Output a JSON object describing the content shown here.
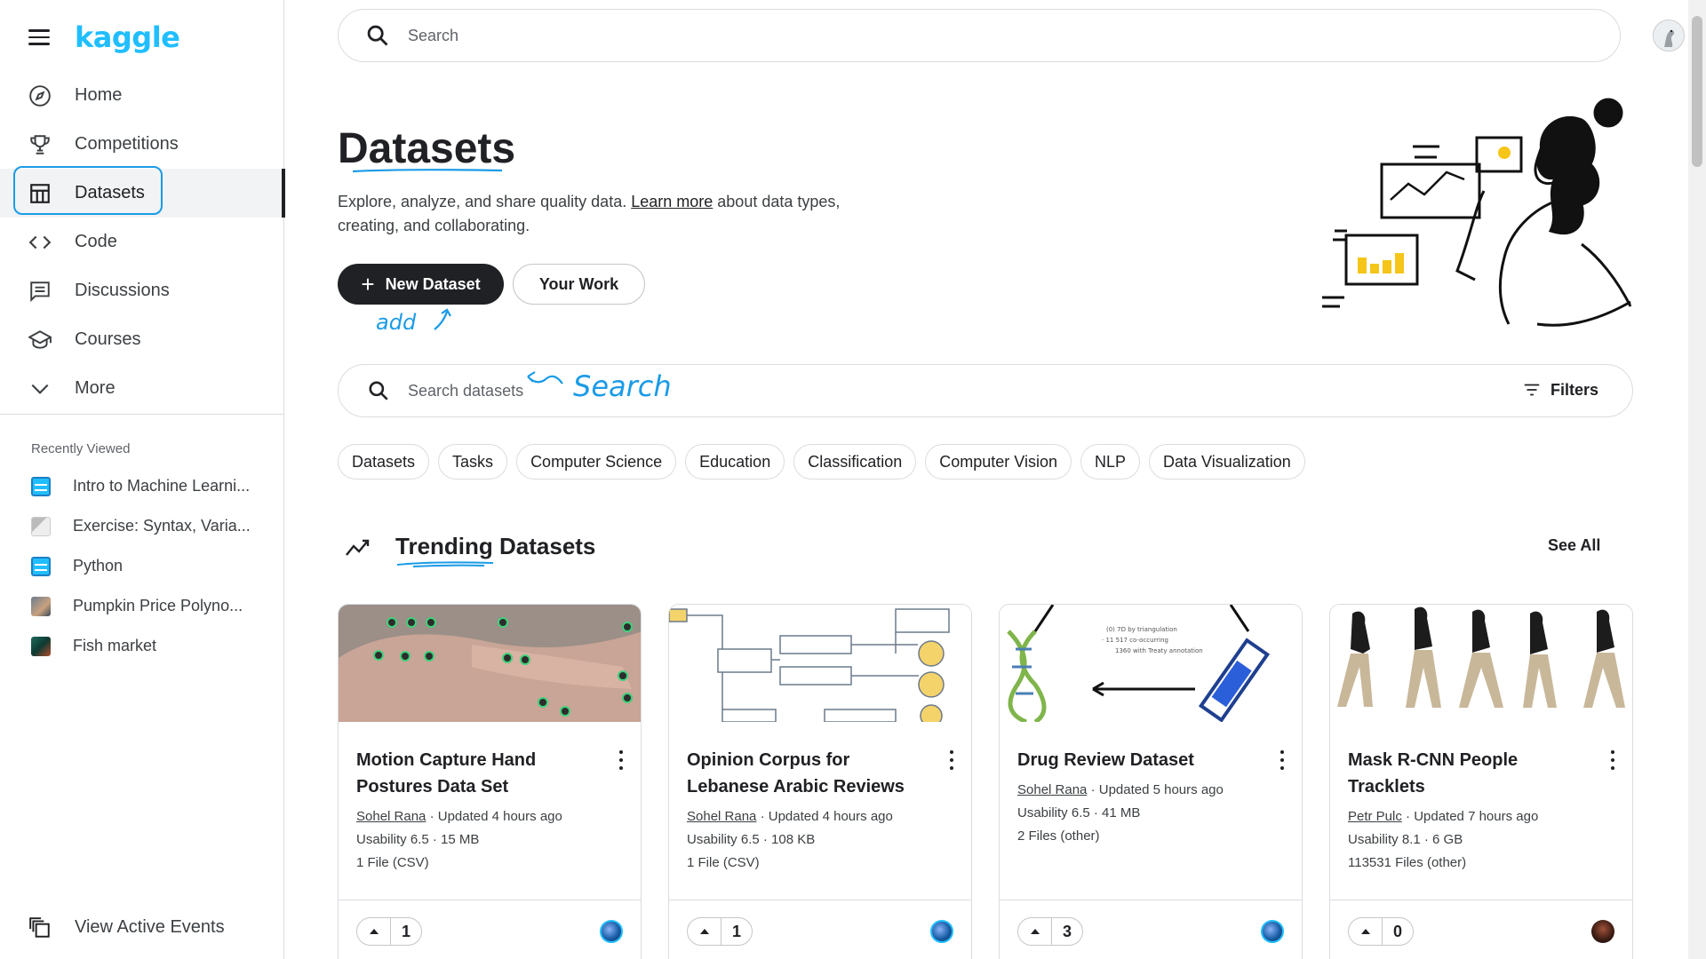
{
  "brand": {
    "logo_text": "kaggle"
  },
  "nav": {
    "items": [
      {
        "label": "Home",
        "icon": "compass-icon"
      },
      {
        "label": "Competitions",
        "icon": "trophy-icon"
      },
      {
        "label": "Datasets",
        "icon": "table-icon"
      },
      {
        "label": "Code",
        "icon": "code-icon"
      },
      {
        "label": "Discussions",
        "icon": "comment-icon"
      },
      {
        "label": "Courses",
        "icon": "school-icon"
      },
      {
        "label": "More",
        "icon": "chevron-down-icon"
      }
    ],
    "active": "Datasets"
  },
  "recent": {
    "title": "Recently Viewed",
    "items": [
      {
        "label": "Intro to Machine Learni..."
      },
      {
        "label": "Exercise: Syntax, Varia..."
      },
      {
        "label": "Python"
      },
      {
        "label": "Pumpkin Price Polyno..."
      },
      {
        "label": "Fish market"
      }
    ]
  },
  "bottom_nav": {
    "label": "View Active Events"
  },
  "topbar": {
    "search_placeholder": "Search"
  },
  "hero": {
    "title": "Datasets",
    "desc_before": "Explore, analyze, and share quality data. ",
    "learn_more": "Learn more",
    "desc_after": " about data types, creating, and collaborating.",
    "new_dataset": "New Dataset",
    "your_work": "Your Work"
  },
  "annotations": {
    "add": "add",
    "search": "Search"
  },
  "dataset_search": {
    "placeholder": "Search datasets",
    "filters": "Filters"
  },
  "chips": [
    "Datasets",
    "Tasks",
    "Computer Science",
    "Education",
    "Classification",
    "Computer Vision",
    "NLP",
    "Data Visualization"
  ],
  "trending": {
    "title": "Trending Datasets",
    "see_all": "See All"
  },
  "cards": [
    {
      "title": "Motion Capture Hand Postures Data Set",
      "author": "Sohel Rana",
      "updated": " · Updated 4 hours ago",
      "usability": "Usability 6.5 · 15 MB",
      "files": "1 File (CSV)",
      "votes": "1"
    },
    {
      "title": "Opinion Corpus for Lebanese Arabic Reviews",
      "author": "Sohel Rana",
      "updated": " · Updated 4 hours ago",
      "usability": "Usability 6.5 · 108 KB",
      "files": "1 File (CSV)",
      "votes": "1"
    },
    {
      "title": "Drug Review Dataset",
      "author": "Sohel Rana",
      "updated": " · Updated 5 hours ago",
      "usability": "Usability 6.5 · 41 MB",
      "files": "2 Files (other)",
      "votes": "3"
    },
    {
      "title": "Mask R-CNN People Tracklets",
      "author": "Petr Pulc",
      "updated": " · Updated 7 hours ago",
      "usability": "Usability 8.1 · 6 GB",
      "files": "113531 Files (other)",
      "votes": "0"
    }
  ],
  "colors": {
    "brand": "#20beff",
    "annotation": "#1a9be6",
    "primary_button": "#202124"
  }
}
